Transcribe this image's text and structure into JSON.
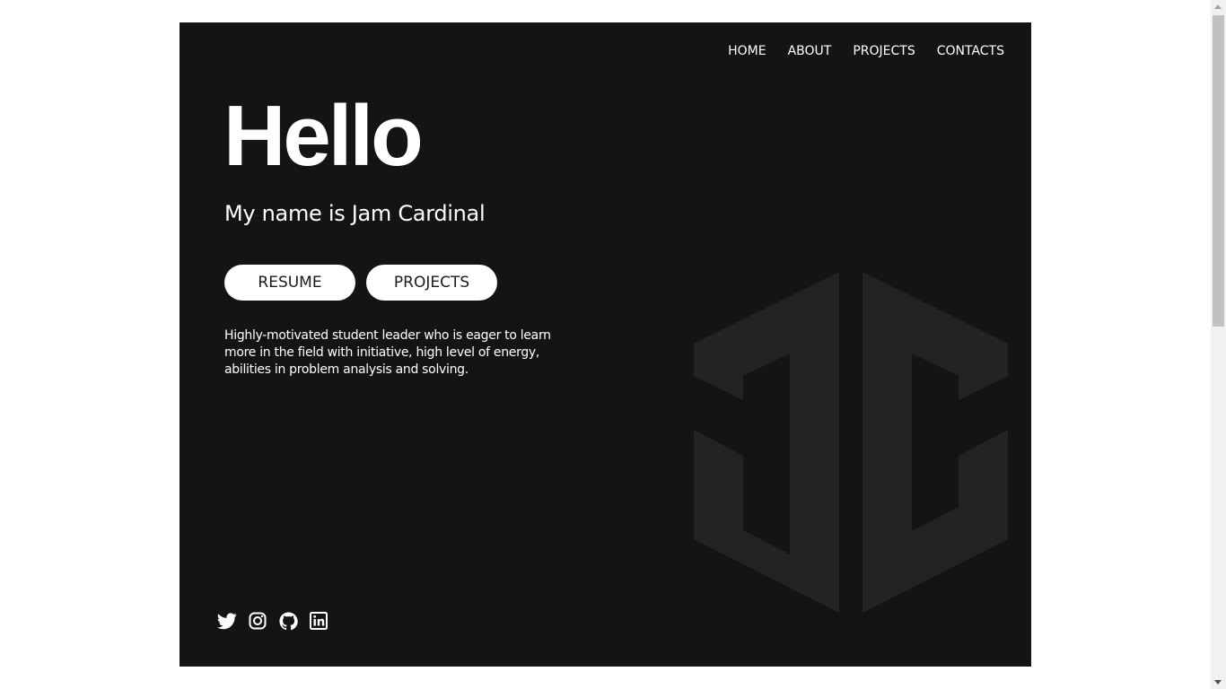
{
  "nav": {
    "items": [
      "HOME",
      "ABOUT",
      "PROJECTS",
      "CONTACTS"
    ]
  },
  "hero": {
    "greeting": "Hello",
    "subtitle": "My name is Jam Cardinal",
    "buttons": {
      "resume": "RESUME",
      "projects": "PROJECTS"
    },
    "description": "Highly-motivated student leader who is eager to learn more in the field with initiative, high level of energy, abilities in problem analysis and solving.",
    "logo_text": "JC"
  },
  "socials": {
    "icons": [
      "twitter-icon",
      "instagram-icon",
      "github-icon",
      "linkedin-icon"
    ]
  },
  "colors": {
    "hero_bg": "#141414",
    "logo": "#232323",
    "text": "#ffffff",
    "button_bg": "#ffffff",
    "button_text": "#1a1a1a"
  }
}
